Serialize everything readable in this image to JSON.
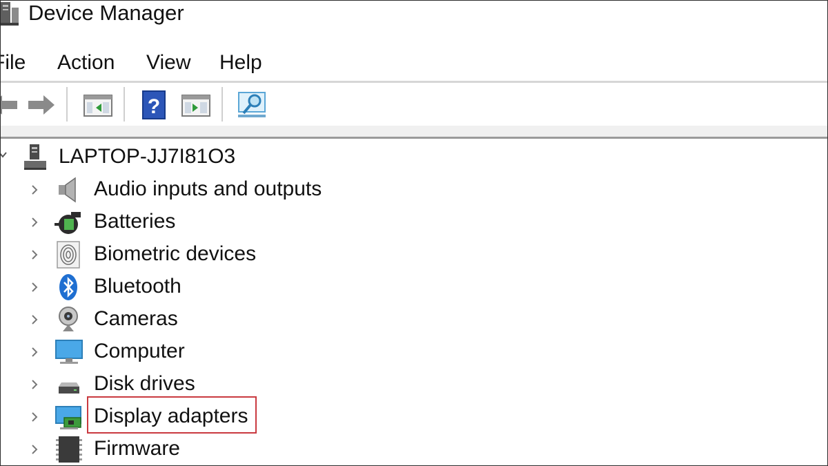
{
  "window": {
    "title": "Device Manager"
  },
  "menu": {
    "items": [
      "File",
      "Action",
      "View",
      "Help"
    ]
  },
  "toolbar": {
    "buttons": [
      {
        "icon": "back-arrow-icon"
      },
      {
        "icon": "forward-arrow-icon"
      },
      {
        "icon": "show-hide-console-tree-icon"
      },
      {
        "icon": "help-icon"
      },
      {
        "icon": "properties-pane-icon"
      },
      {
        "icon": "scan-hardware-changes-icon"
      }
    ],
    "help_glyph": "?"
  },
  "tree": {
    "root": {
      "label": "LAPTOP-JJ7I81O3",
      "expanded": true,
      "icon": "computer-tower-icon"
    },
    "categories": [
      {
        "label": "Audio inputs and outputs",
        "icon": "speaker-icon"
      },
      {
        "label": "Batteries",
        "icon": "battery-plug-icon"
      },
      {
        "label": "Biometric devices",
        "icon": "fingerprint-icon"
      },
      {
        "label": "Bluetooth",
        "icon": "bluetooth-icon"
      },
      {
        "label": "Cameras",
        "icon": "webcam-icon"
      },
      {
        "label": "Computer",
        "icon": "monitor-icon"
      },
      {
        "label": "Disk drives",
        "icon": "disk-drive-icon"
      },
      {
        "label": "Display adapters",
        "icon": "display-adapter-icon",
        "highlighted": true
      },
      {
        "label": "Firmware",
        "icon": "chip-icon"
      }
    ]
  },
  "colors": {
    "highlight": "#c9393f",
    "accent_blue": "#1f6fd1"
  }
}
